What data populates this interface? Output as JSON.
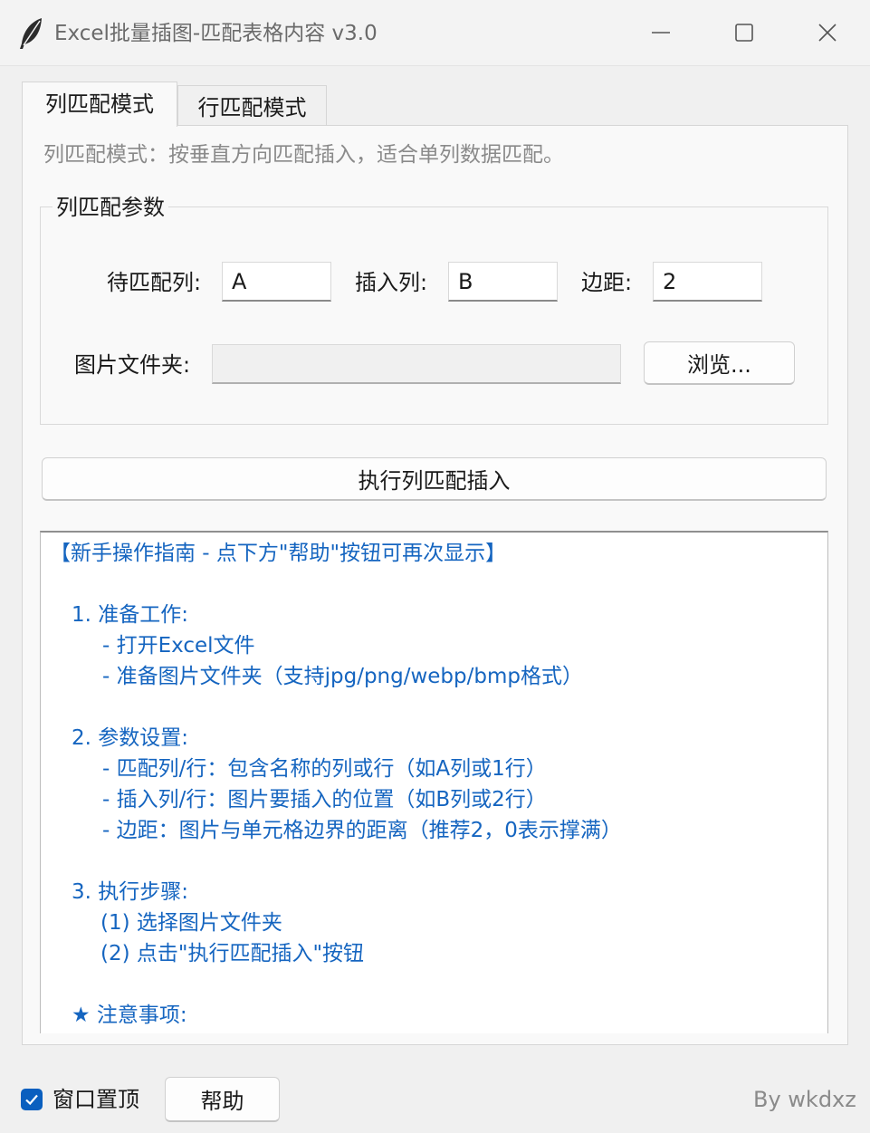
{
  "window": {
    "title": "Excel批量插图-匹配表格内容 v3.0"
  },
  "tabs": [
    {
      "label": "列匹配模式",
      "active": true
    },
    {
      "label": "行匹配模式",
      "active": false
    }
  ],
  "description": "列匹配模式：按垂直方向匹配插入，适合单列数据匹配。",
  "params": {
    "group_title": "列匹配参数",
    "match_col_label": "待匹配列:",
    "match_col_value": "A",
    "insert_col_label": "插入列:",
    "insert_col_value": "B",
    "margin_label": "边距:",
    "margin_value": "2",
    "folder_label": "图片文件夹:",
    "folder_value": "",
    "browse_label": "浏览..."
  },
  "run_button_label": "执行列匹配插入",
  "guide": {
    "lines": [
      "【新手操作指南 - 点下方\"帮助\"按钮可再次显示】",
      "1. 准备工作:",
      "- 打开Excel文件",
      "- 准备图片文件夹（支持jpg/png/webp/bmp格式）",
      "2. 参数设置:",
      "- 匹配列/行：包含名称的列或行（如A列或1行）",
      "- 插入列/行：图片要插入的位置（如B列或2行）",
      "- 边距：图片与单元格边界的距离（推荐2，0表示撑满）",
      "3. 执行步骤:",
      "(1) 选择图片文件夹",
      "(2) 点击\"执行匹配插入\"按钮",
      "★ 注意事项:"
    ]
  },
  "footer": {
    "topmost_label": "窗口置顶",
    "topmost_checked": true,
    "help_label": "帮助",
    "author": "By wkdxz"
  },
  "colors": {
    "accent": "#0a5fbf",
    "guide_text": "#1565c0"
  },
  "icons": {
    "app": "feather-icon",
    "minimize": "minimize-icon",
    "maximize": "maximize-icon",
    "close": "close-icon",
    "check": "checkmark-icon"
  }
}
